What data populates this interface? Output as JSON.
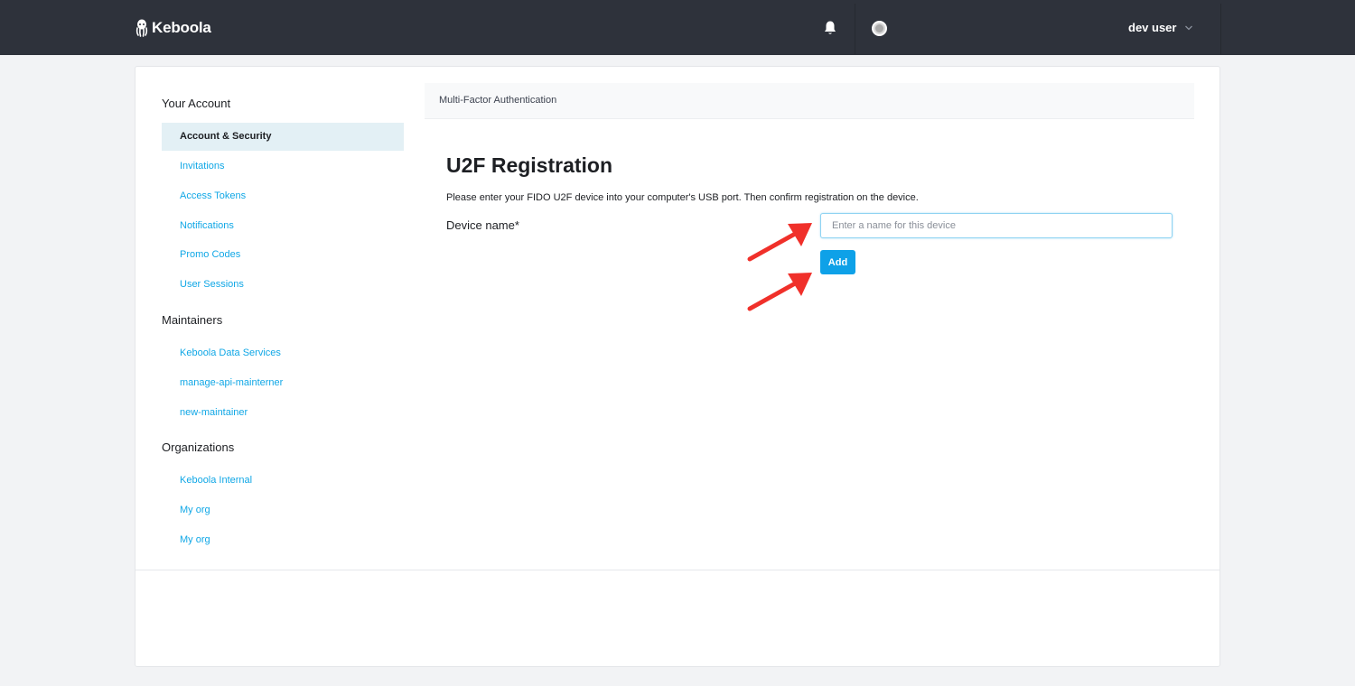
{
  "header": {
    "brand_name": "Keboola",
    "brand_icon": "octopus-logo-icon",
    "notifications_icon": "bell-icon",
    "user_name": "dev user",
    "user_menu_icon": "chevron-down-icon",
    "background_color": "#2e323b"
  },
  "sidebar": {
    "sections": [
      {
        "heading": "Your Account",
        "items": [
          {
            "label": "Account & Security",
            "active": true
          },
          {
            "label": "Invitations",
            "active": false
          },
          {
            "label": "Access Tokens",
            "active": false
          },
          {
            "label": "Notifications",
            "active": false
          },
          {
            "label": "Promo Codes",
            "active": false
          },
          {
            "label": "User Sessions",
            "active": false
          }
        ]
      },
      {
        "heading": "Maintainers",
        "items": [
          {
            "label": "Keboola Data Services",
            "active": false
          },
          {
            "label": "manage-api-mainterner",
            "active": false
          },
          {
            "label": "new-maintainer",
            "active": false
          }
        ]
      },
      {
        "heading": "Organizations",
        "items": [
          {
            "label": "Keboola Internal",
            "active": false
          },
          {
            "label": "My org",
            "active": false
          },
          {
            "label": "My org",
            "active": false
          }
        ]
      }
    ],
    "link_color": "#10a7e6",
    "active_background": "#e3f0f5"
  },
  "main": {
    "breadcrumb": "Multi-Factor Authentication",
    "title": "U2F Registration",
    "description": "Please enter your FIDO U2F device into your computer's USB port. Then confirm registration on the device.",
    "form": {
      "device_name_label": "Device name*",
      "device_name_value": "",
      "device_name_placeholder": "Enter a name for this device",
      "submit_label": "Add",
      "button_color": "#0ea1e8"
    }
  },
  "annotations": {
    "arrow_color": "#f0302a",
    "arrow_count": 2
  }
}
